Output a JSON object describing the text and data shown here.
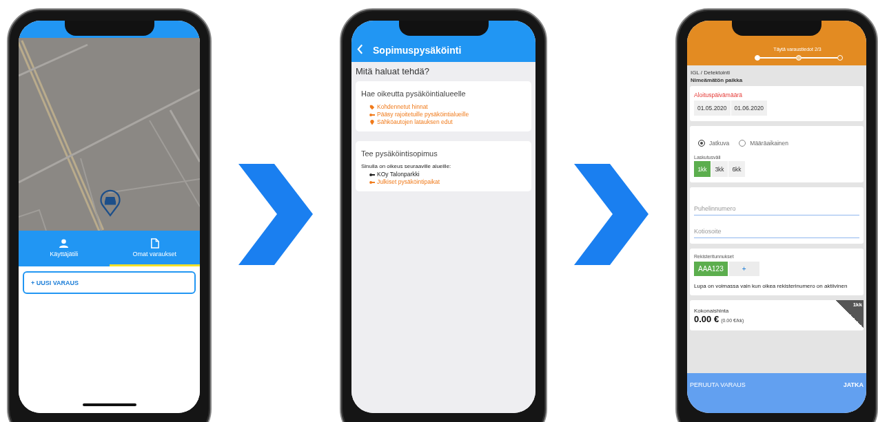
{
  "map_screen": {
    "tabs": [
      {
        "label": "Käyttäjätili",
        "selected": false
      },
      {
        "label": "Omat varaukset",
        "selected": true
      }
    ],
    "new_button": "+ UUSI VARAUS"
  },
  "agreement_screen": {
    "title": "Sopimuspysäköinti",
    "question": "Mitä haluat tehdä?",
    "cards": [
      {
        "title": "Hae oikeutta pysäköintialueelle",
        "items": [
          {
            "text": "Kohdennetut hinnat",
            "color": "#f07a1a"
          },
          {
            "text": "Pääsy rajoitetuille pysäköintialueille",
            "color": "#f07a1a"
          },
          {
            "text": "Sähköautojen latauksen edut",
            "color": "#f07a1a"
          }
        ]
      },
      {
        "title": "Tee pysäköintisopimus",
        "subtitle": "Sinulla on oikeus seuraaville alueille:",
        "items": [
          {
            "text": "KOy Talonparkki",
            "color": "#222222"
          },
          {
            "text": "Julkiset pysäköintipaikat",
            "color": "#f07a1a"
          }
        ]
      }
    ]
  },
  "booking_screen": {
    "step_title": "Täytä varaustiedot 2/3",
    "steps": [
      {
        "kind": "done"
      },
      {
        "kind": "current"
      },
      {
        "kind": "todo"
      }
    ],
    "location": "IGL / Detektointi",
    "place": "Nimeämätön paikka",
    "start_label": "Aloituspäivämäärä",
    "dates": [
      "01.05.2020",
      "01.06.2020"
    ],
    "duration_options": [
      {
        "label": "Jatkuva",
        "selected": true
      },
      {
        "label": "Määräaikainen",
        "selected": false
      }
    ],
    "billing_label": "Laskutusväli",
    "billing_options": [
      {
        "label": "1kk",
        "selected": true
      },
      {
        "label": "3kk",
        "selected": false
      },
      {
        "label": "6kk",
        "selected": false
      }
    ],
    "fields": [
      {
        "placeholder": "Puhelinnumero"
      },
      {
        "placeholder": "Kotiosoite"
      }
    ],
    "plates_label": "Rekisteritunnukset",
    "plates": [
      "AAA123"
    ],
    "add_plate": "+",
    "plate_note": "Lupa on voimassa vain kun oikea rekisterinumero on aktiivinen",
    "price_label": "Kokonaishinta",
    "price": "0.00 €",
    "price_per_month": "(0.00 €/kk)",
    "period_badge": "1kk",
    "cancel_button": "PERUUTA VARAUS",
    "next_button": "JATKA"
  }
}
